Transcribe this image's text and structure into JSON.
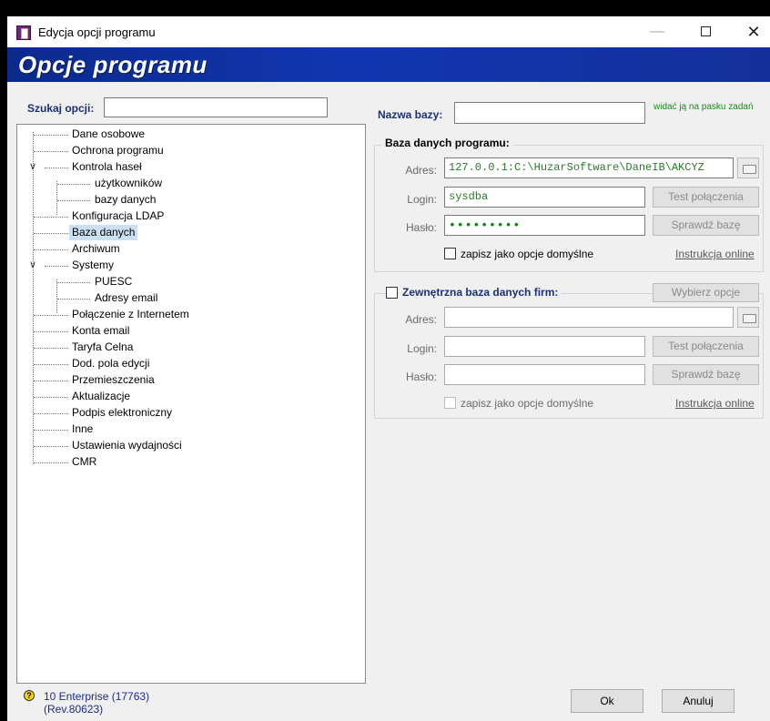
{
  "window": {
    "title": "Edycja opcji programu",
    "minimize": "—",
    "close": "✕"
  },
  "banner": {
    "text": "Opcje programu"
  },
  "search": {
    "label": "Szukaj opcji:",
    "value": ""
  },
  "tree": {
    "items": [
      "Dane osobowe",
      "Ochrona programu",
      "Kontrola haseł",
      "użytkowników",
      "bazy danych",
      "Konfiguracja LDAP",
      "Baza danych",
      "Archiwum",
      "Systemy",
      "PUESC",
      "Adresy email",
      "Połączenie z Internetem",
      "Konta email",
      "Taryfa Celna",
      "Dod. pola edycji",
      "Przemieszczenia",
      "Aktualizacje",
      "Podpis elektroniczny",
      "Inne",
      "Ustawienia wydajności",
      "CMR"
    ],
    "selected": "Baza danych"
  },
  "status": {
    "line1": "10 Enterprise (17763)",
    "line2": "(Rev.80623)"
  },
  "nazwa": {
    "label": "Nazwa bazy:",
    "value": "",
    "hint": "widać ją na pasku zadań"
  },
  "baza": {
    "title": "Baza danych programu:",
    "adres_label": "Adres:",
    "adres_value": "127.0.0.1:C:\\HuzarSoftware\\DaneIB\\AKCYZ",
    "login_label": "Login:",
    "login_value": "sysdba",
    "haslo_label": "Hasło:",
    "haslo_value": "•••••••••",
    "test_button": "Test połączenia",
    "check_button": "Sprawdź bazę",
    "checkbox_label": "zapisz jako opcje domyślne",
    "link": "Instrukcja online"
  },
  "zewn": {
    "title": "Zewnętrzna baza danych firm:",
    "choose_button": "Wybierz opcje",
    "adres_label": "Adres:",
    "adres_value": "",
    "login_label": "Login:",
    "login_value": "",
    "haslo_label": "Hasło:",
    "haslo_value": "",
    "test_button": "Test połączenia",
    "check_button": "Sprawdź bazę",
    "checkbox_label": "zapisz jako opcje domyślne",
    "link": "Instrukcja online"
  },
  "buttons": {
    "ok": "Ok",
    "cancel": "Anuluj"
  }
}
